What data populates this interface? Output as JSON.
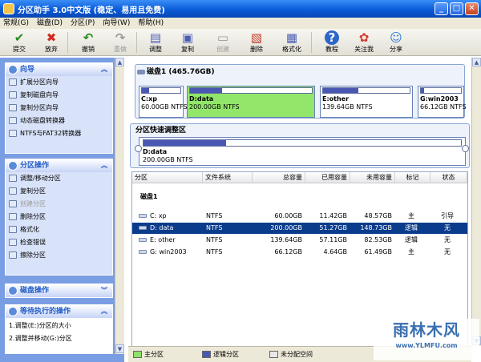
{
  "window": {
    "title": "分区助手 3.0中文版 (稳定、易用且免费)"
  },
  "menu": [
    "常规(G)",
    "磁盘(D)",
    "分区(P)",
    "向导(W)",
    "帮助(H)"
  ],
  "toolbar": [
    {
      "label": "提交",
      "icon": "checkmark-icon",
      "glyph": "✔",
      "color": "#2a8a1f",
      "enabled": true
    },
    {
      "label": "放弃",
      "icon": "cross-icon",
      "glyph": "✖",
      "color": "#d22b1f",
      "enabled": true
    },
    {
      "label": "撤销",
      "icon": "undo-icon",
      "glyph": "↶",
      "color": "#2a8a1f",
      "enabled": true
    },
    {
      "label": "重做",
      "icon": "redo-icon",
      "glyph": "↷",
      "color": "#9a9a9a",
      "enabled": false
    },
    {
      "label": "调整",
      "icon": "resize-disk-icon",
      "glyph": "▤",
      "color": "#4a5db3",
      "enabled": true
    },
    {
      "label": "复制",
      "icon": "copy-disk-icon",
      "glyph": "▣",
      "color": "#4a5db3",
      "enabled": true
    },
    {
      "label": "创建",
      "icon": "create-disk-icon",
      "glyph": "▭",
      "color": "#9a9a9a",
      "enabled": false
    },
    {
      "label": "删除",
      "icon": "delete-disk-icon",
      "glyph": "▧",
      "color": "#c13a2c",
      "enabled": true
    },
    {
      "label": "格式化",
      "icon": "format-disk-icon",
      "glyph": "▦",
      "color": "#4a5db3",
      "enabled": true
    },
    {
      "label": "教程",
      "icon": "help-icon",
      "glyph": "?",
      "color": "#fff",
      "enabled": true
    },
    {
      "label": "关注我",
      "icon": "follow-icon",
      "glyph": "✿",
      "color": "#d33a2c",
      "enabled": true
    },
    {
      "label": "分享",
      "icon": "share-icon",
      "glyph": "☺",
      "color": "#2f7ad6",
      "enabled": true
    }
  ],
  "sidebar": {
    "wizard": {
      "title": "向导",
      "items": [
        {
          "label": "扩展分区向导",
          "icon": "extend-wizard-icon"
        },
        {
          "label": "复制磁盘向导",
          "icon": "copy-disk-wizard-icon"
        },
        {
          "label": "复制分区向导",
          "icon": "copy-partition-wizard-icon"
        },
        {
          "label": "动态磁盘转换器",
          "icon": "dynamic-disk-icon"
        },
        {
          "label": "NTFS与FAT32转换器",
          "icon": "convert-icon"
        }
      ]
    },
    "partition_ops": {
      "title": "分区操作",
      "items": [
        {
          "label": "调整/移动分区",
          "icon": "resize-move-icon",
          "enabled": true
        },
        {
          "label": "复制分区",
          "icon": "copy-partition-icon",
          "enabled": true
        },
        {
          "label": "创建分区",
          "icon": "create-partition-icon",
          "enabled": false
        },
        {
          "label": "删除分区",
          "icon": "delete-partition-icon",
          "enabled": true
        },
        {
          "label": "格式化",
          "icon": "format-icon",
          "enabled": true
        },
        {
          "label": "检查错误",
          "icon": "check-errors-icon",
          "enabled": true
        },
        {
          "label": "擦除分区",
          "icon": "wipe-partition-icon",
          "enabled": true
        }
      ]
    },
    "disk_ops": {
      "title": "磁盘操作"
    },
    "pending": {
      "title": "等待执行的操作",
      "items": [
        "1.调整(E:)分区的大小",
        "2.调整并移动(G:)分区"
      ]
    }
  },
  "disk_map": {
    "header": "磁盘1 (465.76GB)",
    "partitions": [
      {
        "name": "C:xp",
        "size": "60.00GB NTFS",
        "used_fraction": 0.19,
        "selected": false
      },
      {
        "name": "D:data",
        "size": "200.00GB NTFS",
        "used_fraction": 0.26,
        "selected": true
      },
      {
        "name": "E:other",
        "size": "139.64GB NTFS",
        "used_fraction": 0.41,
        "selected": false
      },
      {
        "name": "G:win2003",
        "size": "66.12GB NTFS",
        "used_fraction": 0.07,
        "selected": false
      }
    ]
  },
  "quick_adjust": {
    "title": "分区快速调整区",
    "name": "D:data",
    "size": "200.00GB NTFS",
    "used_fraction": 0.26
  },
  "table": {
    "headers": [
      "分区",
      "文件系统",
      "总容量",
      "已用容量",
      "未用容量",
      "标记",
      "状态"
    ],
    "disk_label": "磁盘1",
    "rows": [
      {
        "partition": "C: xp",
        "fs": "NTFS",
        "total": "60.00GB",
        "used": "11.42GB",
        "free": "48.57GB",
        "flag": "主",
        "status": "引导",
        "selected": false
      },
      {
        "partition": "D: data",
        "fs": "NTFS",
        "total": "200.00GB",
        "used": "51.27GB",
        "free": "148.73GB",
        "flag": "逻辑",
        "status": "无",
        "selected": true
      },
      {
        "partition": "E: other",
        "fs": "NTFS",
        "total": "139.64GB",
        "used": "57.11GB",
        "free": "82.53GB",
        "flag": "逻辑",
        "status": "无",
        "selected": false
      },
      {
        "partition": "G: win2003",
        "fs": "NTFS",
        "total": "66.12GB",
        "used": "4.64GB",
        "free": "61.49GB",
        "flag": "主",
        "status": "无",
        "selected": false
      }
    ]
  },
  "legend": [
    {
      "label": "主分区",
      "color": "#8fe06a"
    },
    {
      "label": "逻辑分区",
      "color": "#4a58b4"
    },
    {
      "label": "未分配空间",
      "color": "#e8e8e8"
    }
  ],
  "watermark": {
    "line1": "雨林木风",
    "line2": "www.YLMFU.com"
  }
}
